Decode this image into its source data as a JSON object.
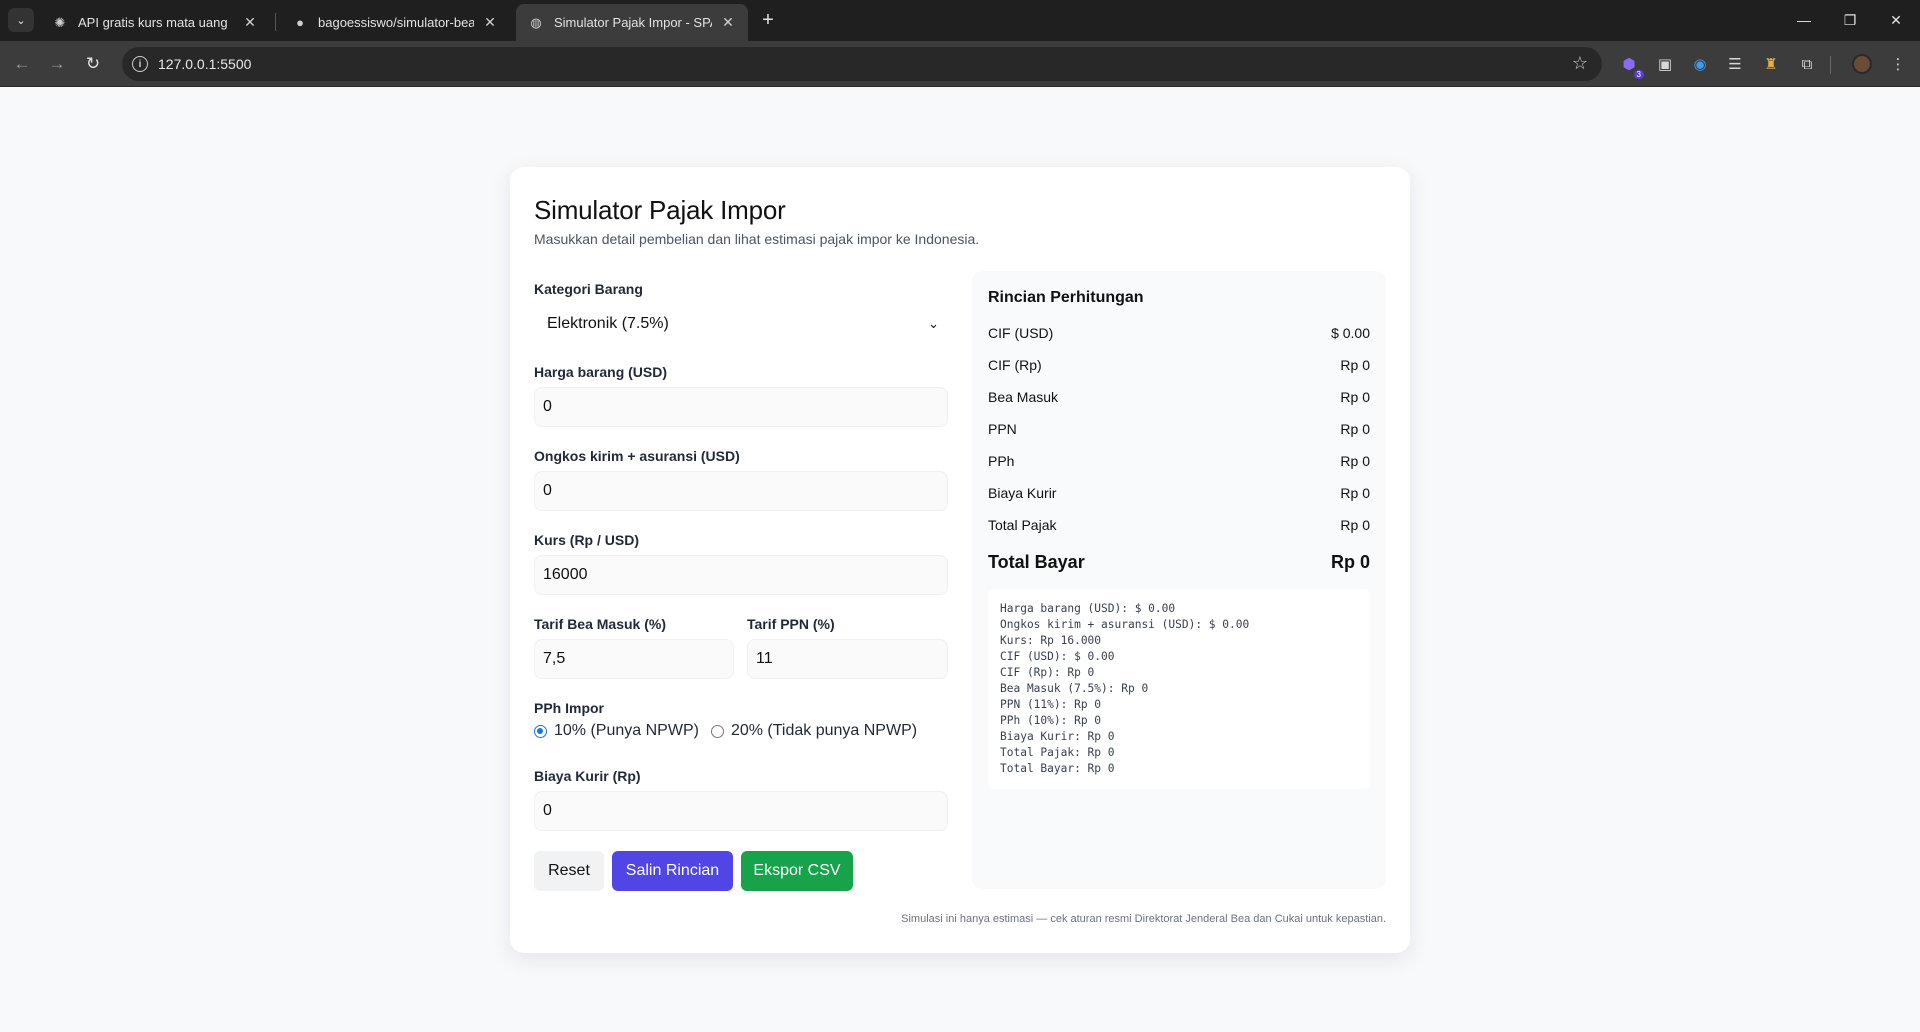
{
  "browser": {
    "tabs": [
      {
        "title": "API gratis kurs mata uang",
        "icon": "openai-icon",
        "active": false
      },
      {
        "title": "bagoessiswo/simulator-bea-imp",
        "icon": "github-icon",
        "active": false
      },
      {
        "title": "Simulator Pajak Impor - SPA",
        "icon": "globe-icon",
        "active": true
      }
    ],
    "new_tab": "+",
    "url": "127.0.0.1:5500",
    "extension_badge": "3"
  },
  "page": {
    "title": "Simulator Pajak Impor",
    "subtitle": "Masukkan detail pembelian dan lihat estimasi pajak impor ke Indonesia.",
    "form": {
      "kategori_label": "Kategori Barang",
      "kategori_value": "Elektronik (7.5%)",
      "harga_label": "Harga barang (USD)",
      "harga_value": "0",
      "ongkir_label": "Ongkos kirim + asuransi (USD)",
      "ongkir_value": "0",
      "kurs_label": "Kurs (Rp / USD)",
      "kurs_value": "16000",
      "bea_label": "Tarif Bea Masuk (%)",
      "bea_value": "7,5",
      "ppn_label": "Tarif PPN (%)",
      "ppn_value": "11",
      "pph_label": "PPh Impor",
      "pph_option1": "10% (Punya NPWP)",
      "pph_option2": "20% (Tidak punya NPWP)",
      "pph_selected": 1,
      "kurir_label": "Biaya Kurir (Rp)",
      "kurir_value": "0"
    },
    "buttons": {
      "reset": "Reset",
      "copy": "Salin Rincian",
      "csv": "Ekspor CSV"
    },
    "summary": {
      "title": "Rincian Perhitungan",
      "rows": [
        {
          "label": "CIF (USD)",
          "value": "$ 0.00"
        },
        {
          "label": "CIF (Rp)",
          "value": "Rp 0"
        },
        {
          "label": "Bea Masuk",
          "value": "Rp 0"
        },
        {
          "label": "PPN",
          "value": "Rp 0"
        },
        {
          "label": "PPh",
          "value": "Rp 0"
        },
        {
          "label": "Biaya Kurir",
          "value": "Rp 0"
        },
        {
          "label": "Total Pajak",
          "value": "Rp 0"
        }
      ],
      "total_label": "Total Bayar",
      "total_value": "Rp 0",
      "detail_lines": [
        "Harga barang (USD): $ 0.00",
        "Ongkos kirim + asuransi (USD): $ 0.00",
        "Kurs: Rp 16.000",
        "CIF (USD): $ 0.00",
        "CIF (Rp): Rp 0",
        "Bea Masuk (7.5%): Rp 0",
        "PPN (11%): Rp 0",
        "PPh (10%): Rp 0",
        "Biaya Kurir: Rp 0",
        "Total Pajak: Rp 0",
        "Total Bayar: Rp 0"
      ]
    },
    "footnote": "Simulasi ini hanya estimasi — cek aturan resmi Direktorat Jenderal Bea dan Cukai untuk kepastian."
  }
}
